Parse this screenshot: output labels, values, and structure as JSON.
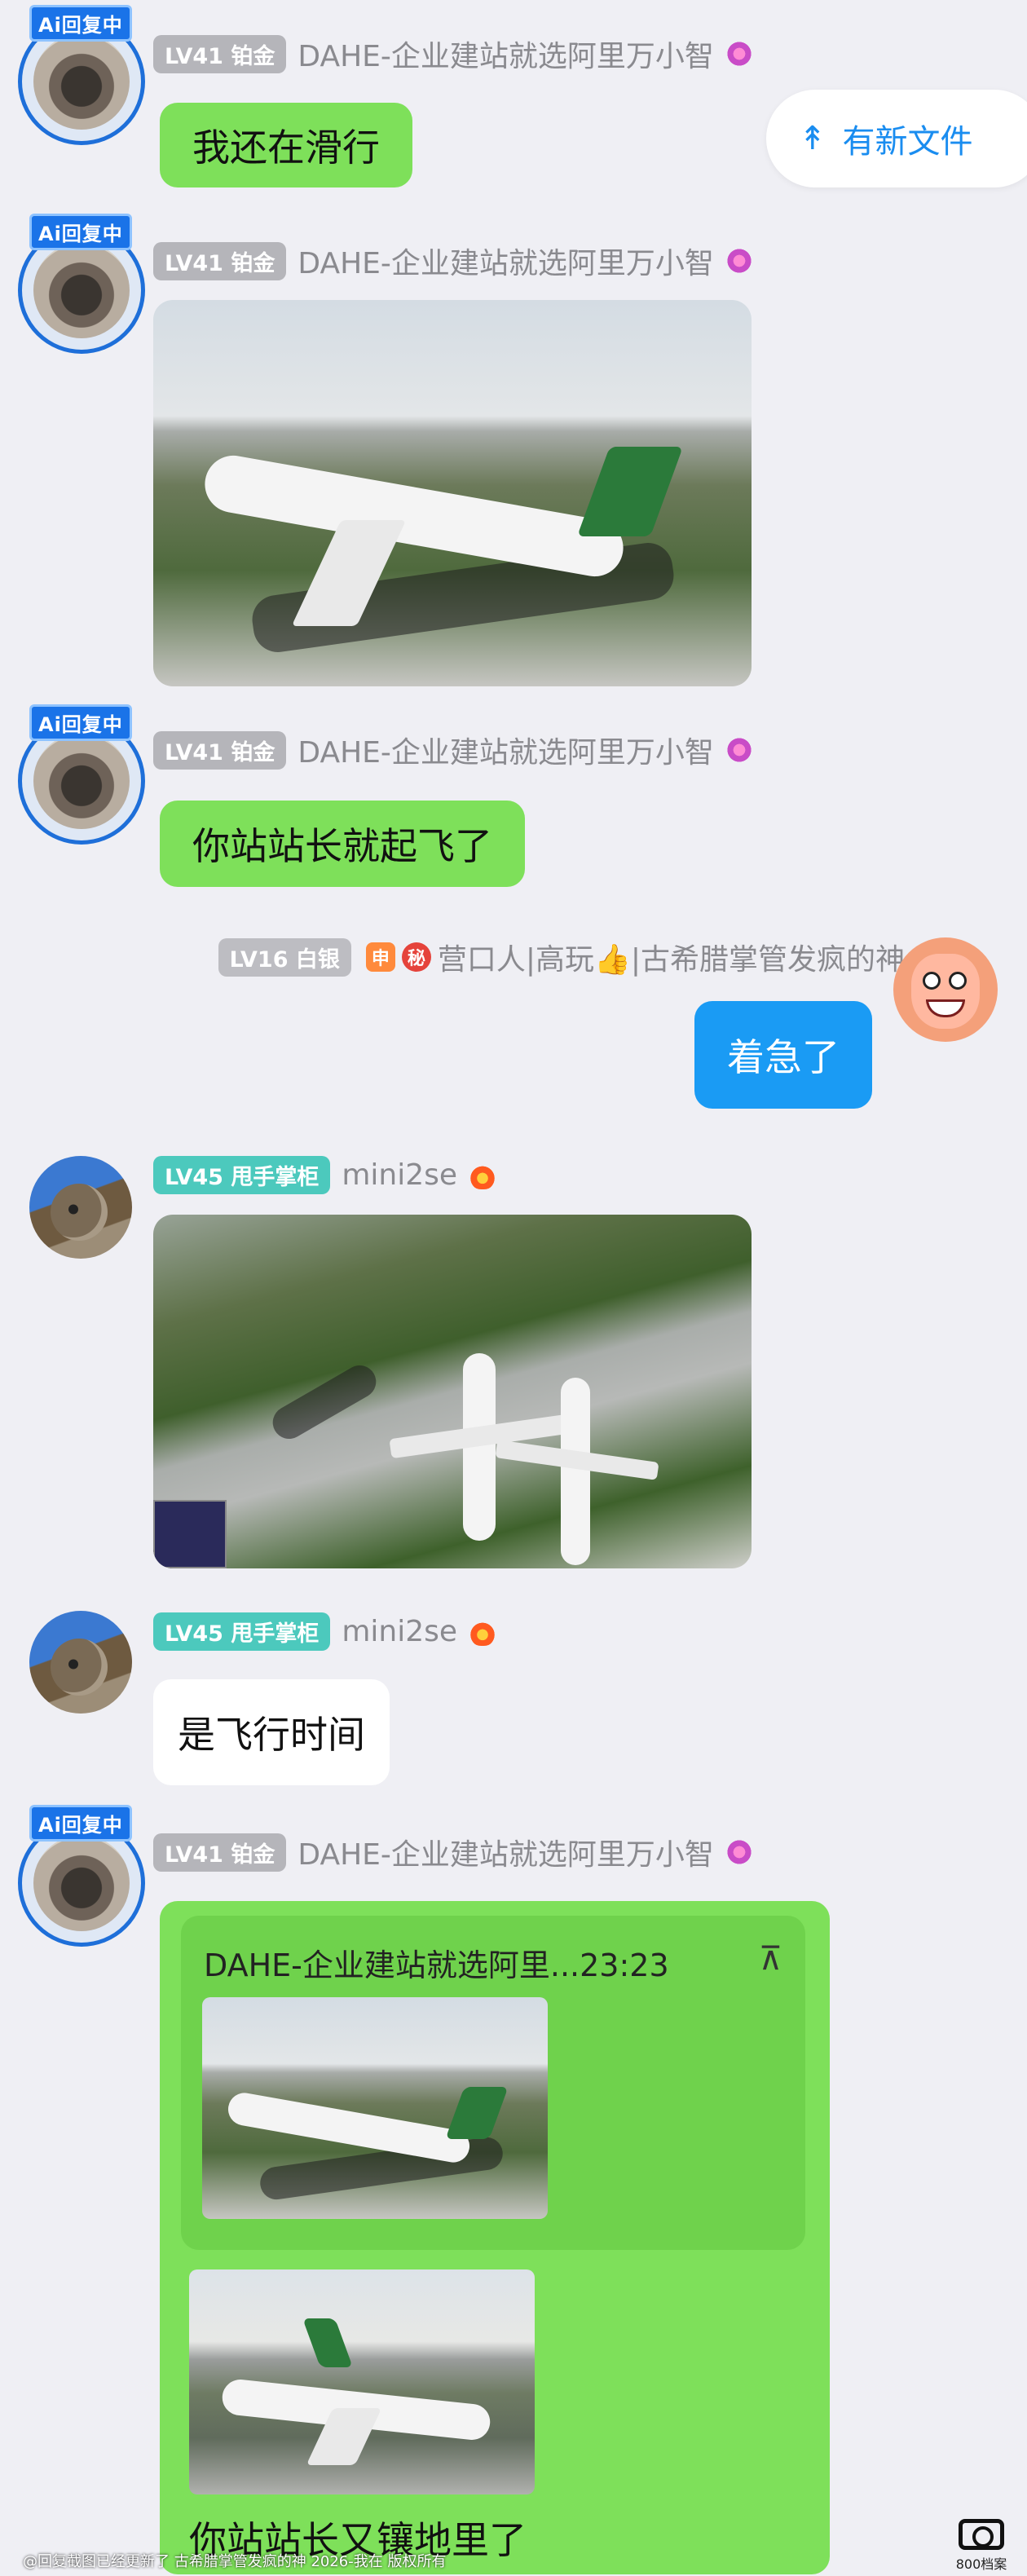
{
  "floating": {
    "new_files_label": "有新文件",
    "new_files_icon": "double-chevron-up-icon"
  },
  "badge_ai": "Ai回复中",
  "messages": [
    {
      "level": "LV41 铂金",
      "name": "DAHE-企业建站就选阿里万小智",
      "text": "我还在滑行"
    },
    {
      "level": "LV41 铂金",
      "name": "DAHE-企业建站就选阿里万小智",
      "image": "airplane-taxi-photo"
    },
    {
      "level": "LV41 铂金",
      "name": "DAHE-企业建站就选阿里万小智",
      "text": "你站站长就起飞了"
    },
    {
      "level": "LV16 白银",
      "name": "营口人|高玩👍|古希腊掌管发疯的神",
      "text": "着急了",
      "tag1": "申",
      "tag2": "秘"
    },
    {
      "level": "LV45 甩手掌柜",
      "name": "mini2se",
      "image": "two-airplanes-runway-photo"
    },
    {
      "level": "LV45 甩手掌柜",
      "name": "mini2se",
      "text": "是飞行时间"
    },
    {
      "level": "LV41 铂金",
      "name": "DAHE-企业建站就选阿里万小智",
      "quote_title": "DAHE-企业建站就选阿里...23:23",
      "text": "你站站长又镶地里了"
    }
  ],
  "watermark": "@回复截图已经更新了 古希腊掌管发疯的神 2026-我在 版权所有",
  "logo_text": "800档案站",
  "colors": {
    "green_bubble": "#7ee05a",
    "blue_bubble": "#1a9bf4",
    "accent": "#1a8df0",
    "background": "#efeff4"
  }
}
